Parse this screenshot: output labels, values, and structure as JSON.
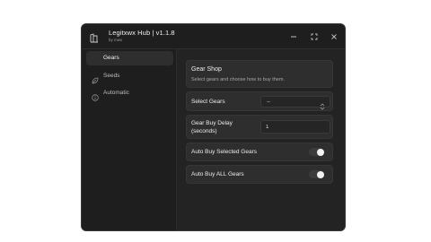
{
  "window": {
    "title": "Legitxwx Hub | v1.1.8",
    "subtitle": "by mwx",
    "controls": [
      "minimize-icon",
      "maximize-icon",
      "close-icon"
    ]
  },
  "sidebar": {
    "items": [
      {
        "label": "Gears",
        "icon": "gear-icon",
        "active": true
      },
      {
        "label": "Seeds",
        "icon": "leaf-icon",
        "active": false
      },
      {
        "label": "Automatic",
        "icon": "info-icon",
        "active": false
      }
    ]
  },
  "main": {
    "header": {
      "title": "Gear Shop",
      "description": "Select gears and choose how to buy them."
    },
    "select_gears": {
      "label": "Select Gears",
      "value": "--"
    },
    "buy_delay": {
      "label_line1": "Gear Buy Delay",
      "label_line2": "(seconds)",
      "value": "1"
    },
    "auto_buy_selected": {
      "label": "Auto Buy Selected Gears",
      "enabled": false
    },
    "auto_buy_all": {
      "label": "Auto Buy ALL Gears",
      "enabled": false
    }
  },
  "colors": {
    "window_bg": "#232323",
    "sidebar_bg": "#1e1e1e",
    "card_bg": "#2e2e2e",
    "text": "#e6e6e6",
    "muted_text": "#a8a8a8"
  }
}
